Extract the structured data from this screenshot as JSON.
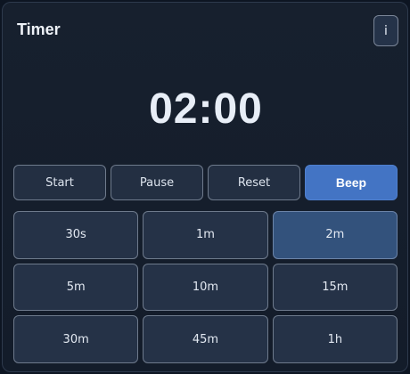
{
  "header": {
    "title": "Timer",
    "info_label": "i"
  },
  "display": {
    "time": "02:00"
  },
  "controls": {
    "start_label": "Start",
    "pause_label": "Pause",
    "reset_label": "Reset",
    "beep_label": "Beep"
  },
  "presets": [
    {
      "label": "30s"
    },
    {
      "label": "1m"
    },
    {
      "label": "2m",
      "selected": true
    },
    {
      "label": "5m"
    },
    {
      "label": "10m"
    },
    {
      "label": "15m"
    },
    {
      "label": "30m"
    },
    {
      "label": "45m"
    },
    {
      "label": "1h"
    }
  ],
  "colors": {
    "accent": "#4374c4",
    "selected_preset": "#33527c",
    "background": "#131c2a"
  }
}
